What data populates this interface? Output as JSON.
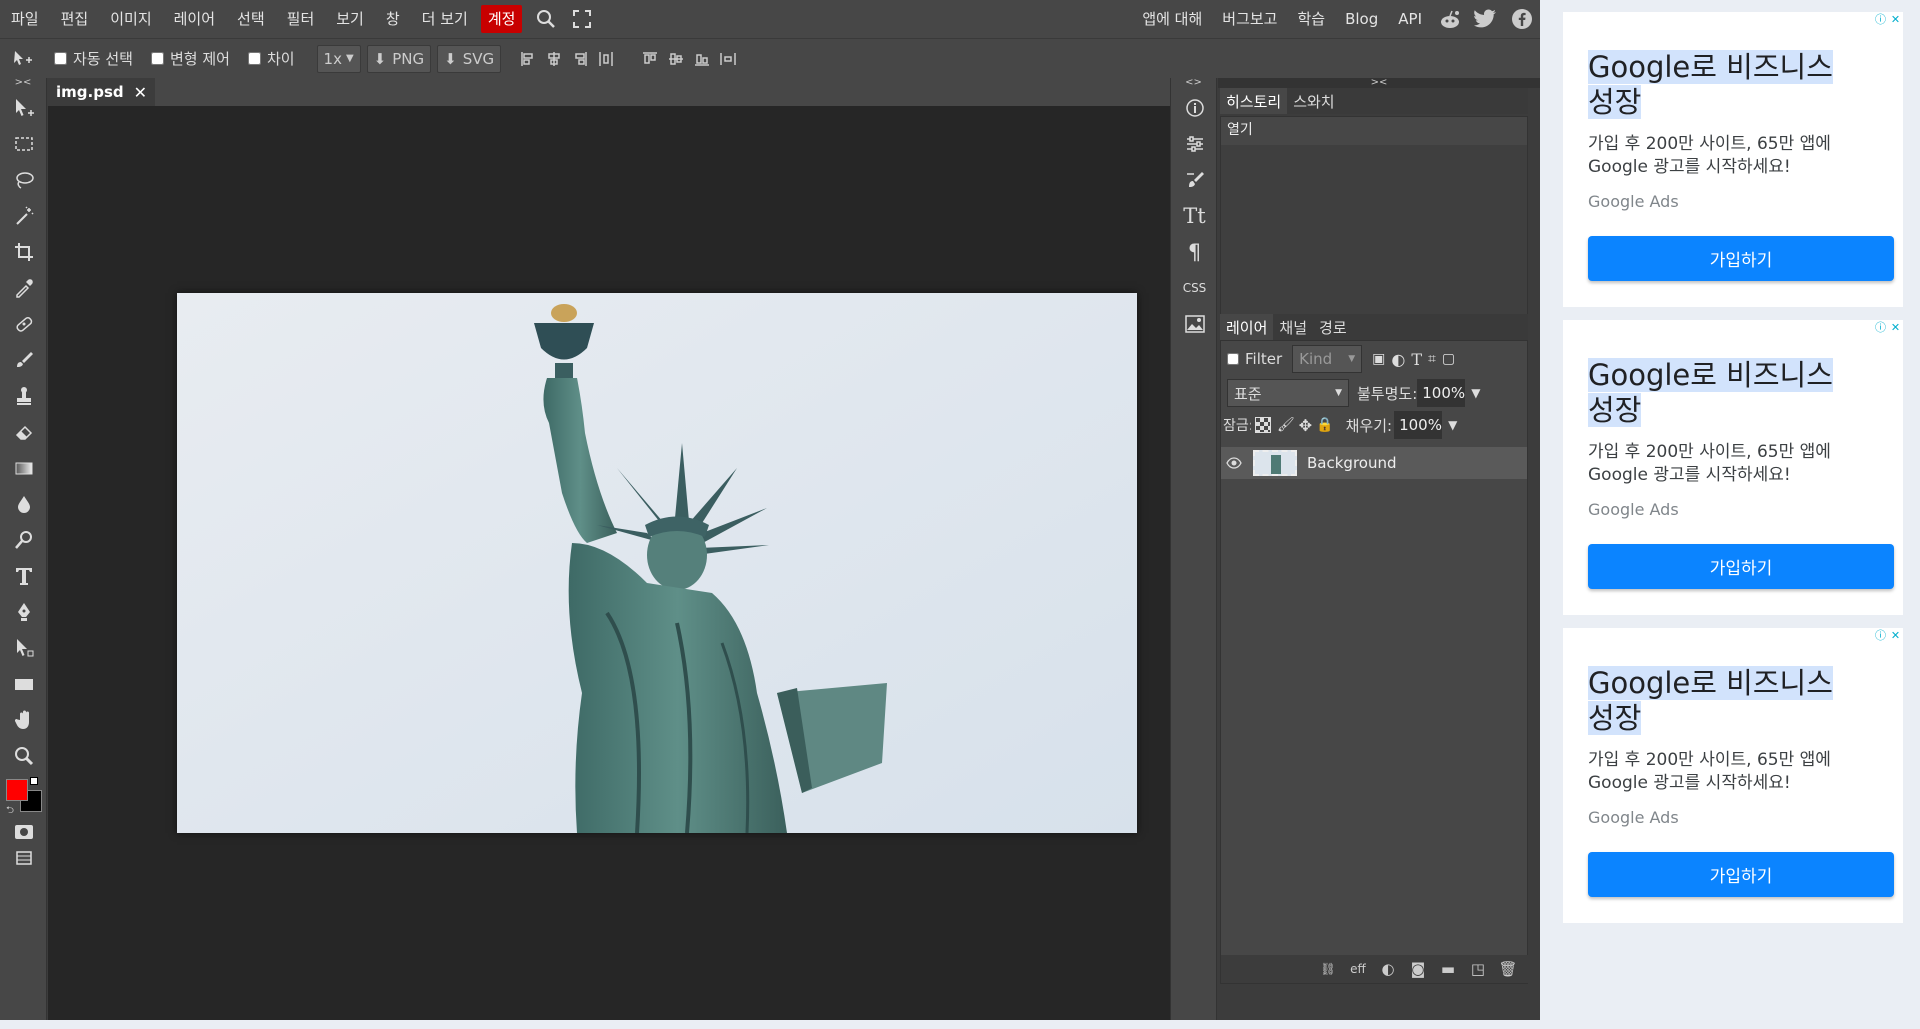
{
  "menubar": {
    "items": [
      "파일",
      "편집",
      "이미지",
      "레이어",
      "선택",
      "필터",
      "보기",
      "창",
      "더 보기"
    ],
    "account": "계정",
    "right_items": [
      "앱에 대해",
      "버그보고",
      "학습",
      "Blog",
      "API"
    ],
    "icons": [
      "search-icon",
      "fullscreen-icon",
      "reddit-icon",
      "twitter-icon",
      "facebook-icon"
    ]
  },
  "options": {
    "auto_select": "자동 선택",
    "transform": "변형 제어",
    "distance": "차이",
    "scale": "1x",
    "png": "PNG",
    "svg": "SVG"
  },
  "document": {
    "tab_name": "img.psd",
    "close": "✕"
  },
  "panels": {
    "history_tab": "히스토리",
    "swatch_tab": "스와치",
    "history_item": "열기",
    "layers_tab": "레이어",
    "channels_tab": "채널",
    "paths_tab": "경로",
    "filter_label": "Filter",
    "kind_placeholder": "Kind",
    "blend_mode": "표준",
    "opacity_label": "불투명도:",
    "opacity_value": "100%",
    "lock_label": "잠금:",
    "fill_label": "채우기:",
    "fill_value": "100%",
    "layer_name": "Background",
    "footer_eff": "eff"
  },
  "colors": {
    "foreground": "#ff0000",
    "background": "#000000",
    "accent_account": "#c80000",
    "ad_button": "#0b84ff"
  },
  "ads": [
    {
      "title_line1": "Google로 비즈니스",
      "title_line2": "성장",
      "desc": "가입 후 200만 사이트, 65만 앱에 Google 광고를 시작하세요!",
      "brand": "Google Ads",
      "button": "가입하기"
    },
    {
      "title_line1": "Google로 비즈니스",
      "title_line2": "성장",
      "desc": "가입 후 200만 사이트, 65만 앱에 Google 광고를 시작하세요!",
      "brand": "Google Ads",
      "button": "가입하기"
    },
    {
      "title_line1": "Google로 비즈니스",
      "title_line2": "성장",
      "desc": "가입 후 200만 사이트, 65만 앱에 Google 광고를 시작하세요!",
      "brand": "Google Ads",
      "button": "가입하기"
    }
  ]
}
